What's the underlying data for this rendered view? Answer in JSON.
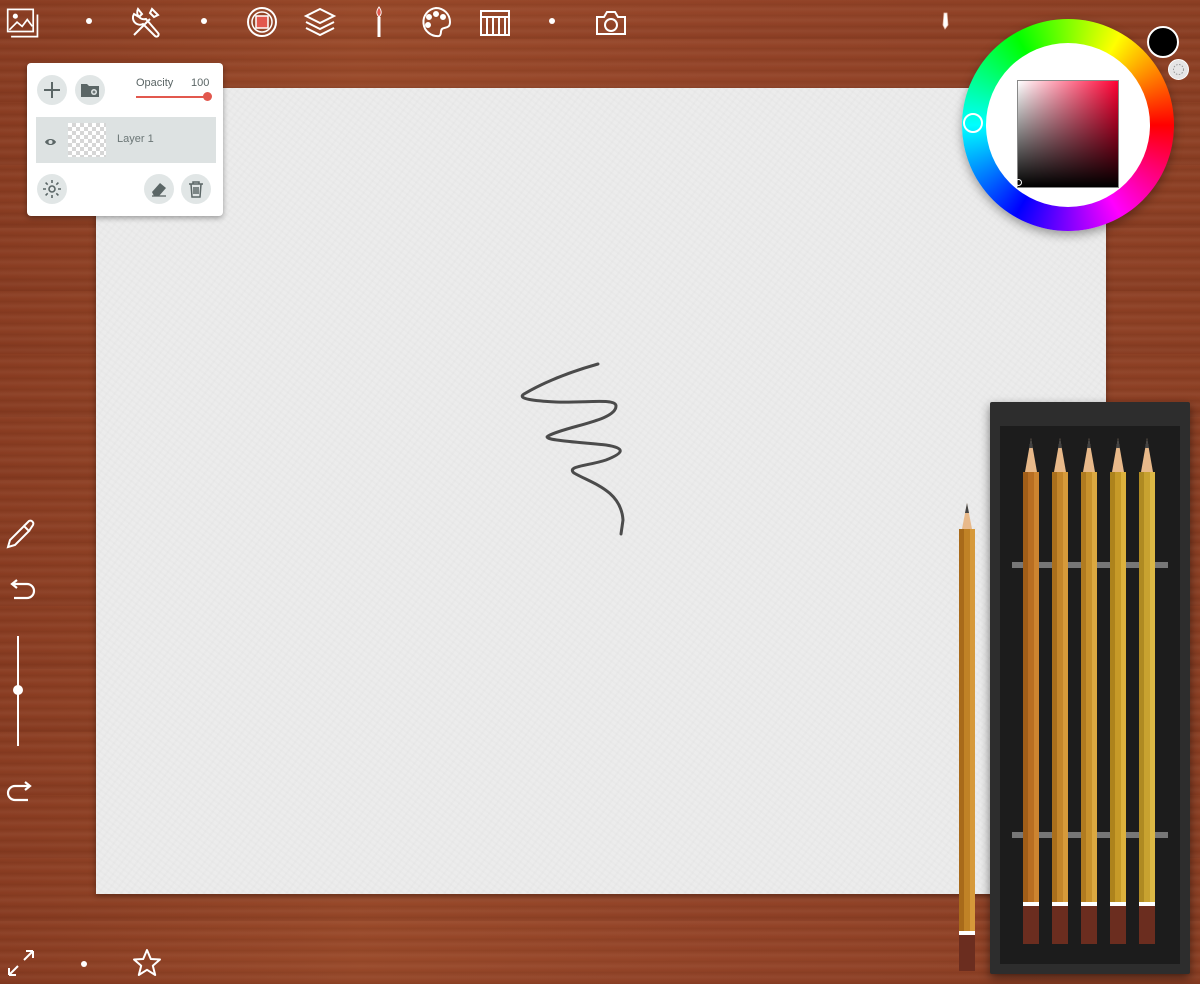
{
  "layers_panel": {
    "opacity_label": "Opacity",
    "opacity_value": "100",
    "layer_name": "Layer 1"
  },
  "icons": {
    "gallery": "gallery-icon",
    "tools": "tools-icon",
    "record": "record-icon",
    "layers": "layers-icon",
    "brush": "brush-icon",
    "palette": "palette-icon",
    "reference": "reference-icon",
    "camera": "camera-icon",
    "eyedropper": "eyedropper-icon",
    "undo": "undo-icon",
    "redo": "redo-icon",
    "fullscreen": "fullscreen-icon",
    "favorite": "star-icon"
  },
  "colors": {
    "wood": "#944428",
    "accent": "#e2584e",
    "current_color": "#000000"
  },
  "brush_size_level": 0.5
}
